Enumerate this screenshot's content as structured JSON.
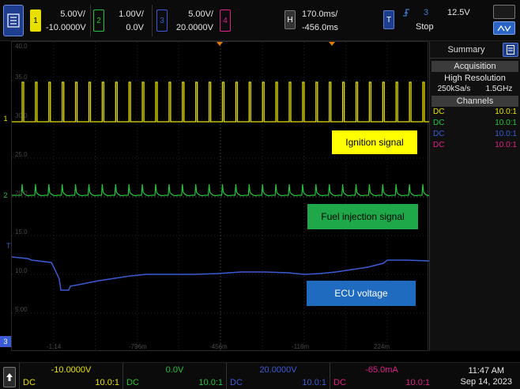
{
  "channels": [
    {
      "num": "1",
      "scale": "5.00V/",
      "offset": "-10.0000V",
      "color": "#e8e000",
      "coupling": "DC",
      "probe": "10.0:1"
    },
    {
      "num": "2",
      "scale": "1.00V/",
      "offset": "0.0V",
      "color": "#22c43a",
      "coupling": "DC",
      "probe": "10.0:1"
    },
    {
      "num": "3",
      "scale": "5.00V/",
      "offset": "20.0000V",
      "color": "#3b5bd6",
      "coupling": "DC",
      "probe": "10.0:1"
    },
    {
      "num": "4",
      "scale": "",
      "offset": "",
      "color": "#e0208a",
      "coupling": "DC",
      "probe": "10.0:1"
    }
  ],
  "horizontal": {
    "badge": "H",
    "timebase": "170.0ms/",
    "delay": "-456.0ms"
  },
  "trigger": {
    "badge": "T",
    "slope_icon": "rising-edge-icon",
    "source": "3",
    "level": "12.5V",
    "status": "Stop"
  },
  "grid": {
    "y_labels": [
      "40.0",
      "35.0",
      "30.0",
      "25.0",
      "20.0",
      "15.0",
      "10.0",
      "5.00"
    ],
    "x_labels": [
      "-1.14",
      "-796m",
      "-456m",
      "-116m",
      "224m"
    ]
  },
  "signal_labels": {
    "ignition": "Ignition signal",
    "fuel": "Fuel injection signal",
    "ecu": "ECU voltage"
  },
  "annotation_colors": {
    "ignition_bg": "#ffff00",
    "fuel_bg": "#1ea84a",
    "ecu_bg": "#1f6bc0"
  },
  "panel": {
    "tab": "Summary",
    "acquisition_title": "Acquisition",
    "acq_mode": "High Resolution",
    "sample_rate": "250kSa/s",
    "bandwidth": "1.5GHz",
    "channels_title": "Channels"
  },
  "bottom": {
    "ch1_offset": "-10.0000V",
    "ch2_offset": "0.0V",
    "ch3_offset": "20.0000V",
    "ch4_offset": "-65.0mA",
    "time": "11:47 AM",
    "date": "Sep 14, 2023"
  }
}
